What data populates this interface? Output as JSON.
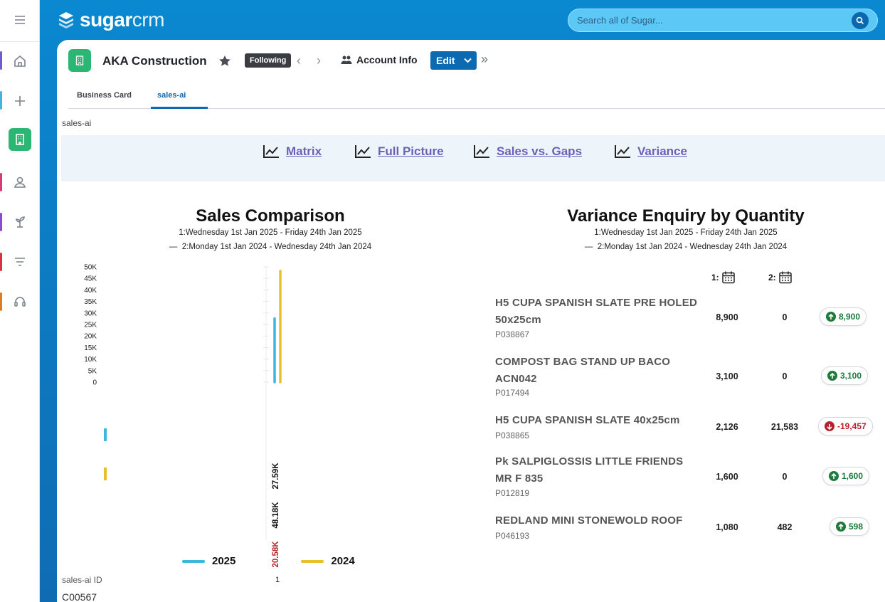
{
  "app": {
    "logo_brand": "sugar",
    "logo_suffix": "crm"
  },
  "search": {
    "placeholder": "Search all of Sugar..."
  },
  "record": {
    "title": "AKA Construction",
    "following_label": "Following",
    "view_label": "Account Info",
    "edit_label": "Edit"
  },
  "tabs": [
    {
      "label": "Business Card",
      "active": false
    },
    {
      "label": "sales-ai",
      "active": true
    }
  ],
  "dashlet_label": "sales-ai",
  "links": [
    "Matrix",
    "Full Picture",
    "Sales vs. Gaps",
    "Variance"
  ],
  "sales_comparison": {
    "title": "Sales Comparison",
    "range1": "1:Wednesday 1st Jan 2025 - Friday 24th Jan 2025",
    "range2": "2:Monday 1st Jan 2024 - Wednesday 24th Jan 2024",
    "range2_prefix": "—"
  },
  "chart_data": {
    "type": "bar",
    "categories": [
      "1"
    ],
    "series": [
      {
        "name": "2025",
        "values": [
          27590
        ],
        "color": "#3fb6dc"
      },
      {
        "name": "2024",
        "values": [
          48180
        ],
        "color": "#e8c12a"
      }
    ],
    "ylim": [
      0,
      50000
    ],
    "yticks": [
      "0",
      "5K",
      "10K",
      "15K",
      "20K",
      "25K",
      "30K",
      "35K",
      "40K",
      "45K",
      "50K"
    ],
    "data_labels": [
      "27.59K",
      "48.18K",
      "20.58K"
    ],
    "difference_label_color": "#b8202b",
    "legend": [
      "2025",
      "2024"
    ],
    "legend_position": "bottom"
  },
  "variance": {
    "title": "Variance Enquiry by Quantity",
    "range1": "1:Wednesday 1st Jan 2025 - Friday 24th Jan 2025",
    "range2": "2:Monday 1st Jan 2024 - Wednesday 24th Jan 2024",
    "range2_prefix": "—",
    "col1_label": "1:",
    "col2_label": "2:",
    "rows": [
      {
        "name": "H5 CUPA SPANISH SLATE PRE HOLED 50x25cm",
        "code": "P038867",
        "v1": "8,900",
        "v2": "0",
        "diff": "8,900",
        "dir": "up"
      },
      {
        "name": "COMPOST BAG STAND UP BACO ACN042",
        "code": "P017494",
        "v1": "3,100",
        "v2": "0",
        "diff": "3,100",
        "dir": "up"
      },
      {
        "name": "H5 CUPA SPANISH SLATE 40x25cm",
        "code": "P038865",
        "v1": "2,126",
        "v2": "21,583",
        "diff": "-19,457",
        "dir": "down"
      },
      {
        "name": "Pk SALPIGLOSSIS LITTLE FRIENDS MR F 835",
        "code": "P012819",
        "v1": "1,600",
        "v2": "0",
        "diff": "1,600",
        "dir": "up"
      },
      {
        "name": "REDLAND MINI STONEWOLD ROOF",
        "code": "P046193",
        "v1": "1,080",
        "v2": "482",
        "diff": "598",
        "dir": "up"
      }
    ]
  },
  "id_field": {
    "label": "sales-ai ID",
    "value": "C00567"
  },
  "colors": {
    "brand": "#0c6ab0",
    "accent": "#2bb673",
    "link": "#6b60b8",
    "up": "#1d7a3a",
    "down": "#b8202b"
  },
  "rail_icons": [
    "menu-icon",
    "home-icon",
    "plus-icon",
    "building-icon",
    "contact-icon",
    "plant-icon",
    "filter-icon",
    "headset-icon"
  ]
}
